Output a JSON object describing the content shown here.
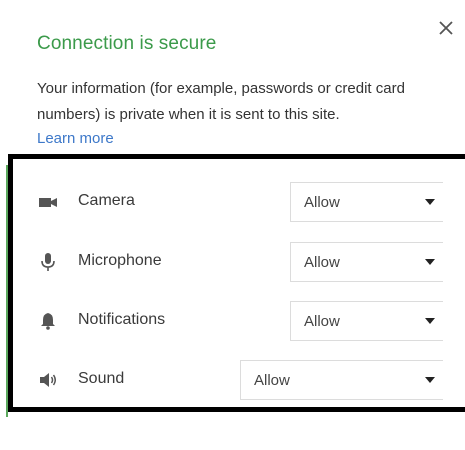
{
  "header": {
    "title": "Connection is secure",
    "description": "Your information (for example, passwords or credit card numbers) is private when it is sent to this site.",
    "learn_more": "Learn more",
    "close_icon": "close-icon"
  },
  "colors": {
    "title": "#3b9a4a",
    "link": "#3d78c9",
    "frame": "#000000",
    "accent_rule": "#5aa85c"
  },
  "permissions": [
    {
      "label": "Camera",
      "value": "Allow",
      "icon": "camera-icon"
    },
    {
      "label": "Microphone",
      "value": "Allow",
      "icon": "microphone-icon"
    },
    {
      "label": "Notifications",
      "value": "Allow",
      "icon": "bell-icon"
    },
    {
      "label": "Sound",
      "value": "Allow",
      "icon": "speaker-icon"
    }
  ]
}
